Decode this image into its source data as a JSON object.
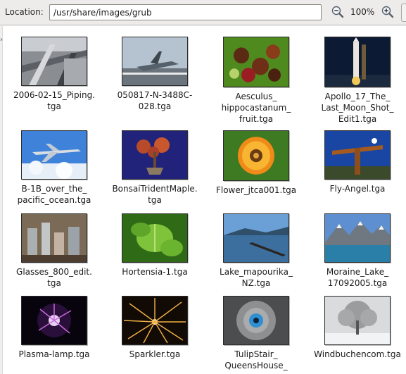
{
  "toolbar": {
    "location_label": "Location:",
    "location_value": "/usr/share/images/grub",
    "zoom_level": "100%",
    "zoom_out_icon": "zoom-out-icon",
    "zoom_in_icon": "zoom-in-icon"
  },
  "files": [
    {
      "name": "2006-02-15_Piping.\ntga",
      "thumb": "piping"
    },
    {
      "name": "050817-N-3488C-\n028.tga",
      "thumb": "jet"
    },
    {
      "name": "Aesculus_\nhippocastanum_\nfruit.tga",
      "thumb": "chestnut"
    },
    {
      "name": "Apollo_17_The_\nLast_Moon_Shot_\nEdit1.tga",
      "thumb": "rocket"
    },
    {
      "name": "B-1B_over_the_\npacific_ocean.tga",
      "thumb": "bomber"
    },
    {
      "name": "BonsaiTridentMaple.\ntga",
      "thumb": "bonsai"
    },
    {
      "name": "Flower_jtca001.tga",
      "thumb": "flower"
    },
    {
      "name": "Fly-Angel.tga",
      "thumb": "angel"
    },
    {
      "name": "Glasses_800_edit.\ntga",
      "thumb": "glasses"
    },
    {
      "name": "Hortensia-1.tga",
      "thumb": "leaves"
    },
    {
      "name": "Lake_mapourika_\nNZ.tga",
      "thumb": "lake"
    },
    {
      "name": "Moraine_Lake_\n17092005.tga",
      "thumb": "mountain"
    },
    {
      "name": "Plasma-lamp.tga",
      "thumb": "plasma"
    },
    {
      "name": "Sparkler.tga",
      "thumb": "sparkler"
    },
    {
      "name": "TulipStair_\nQueensHouse_",
      "thumb": "stair"
    },
    {
      "name": "Windbuchencom.tga",
      "thumb": "tree"
    }
  ]
}
